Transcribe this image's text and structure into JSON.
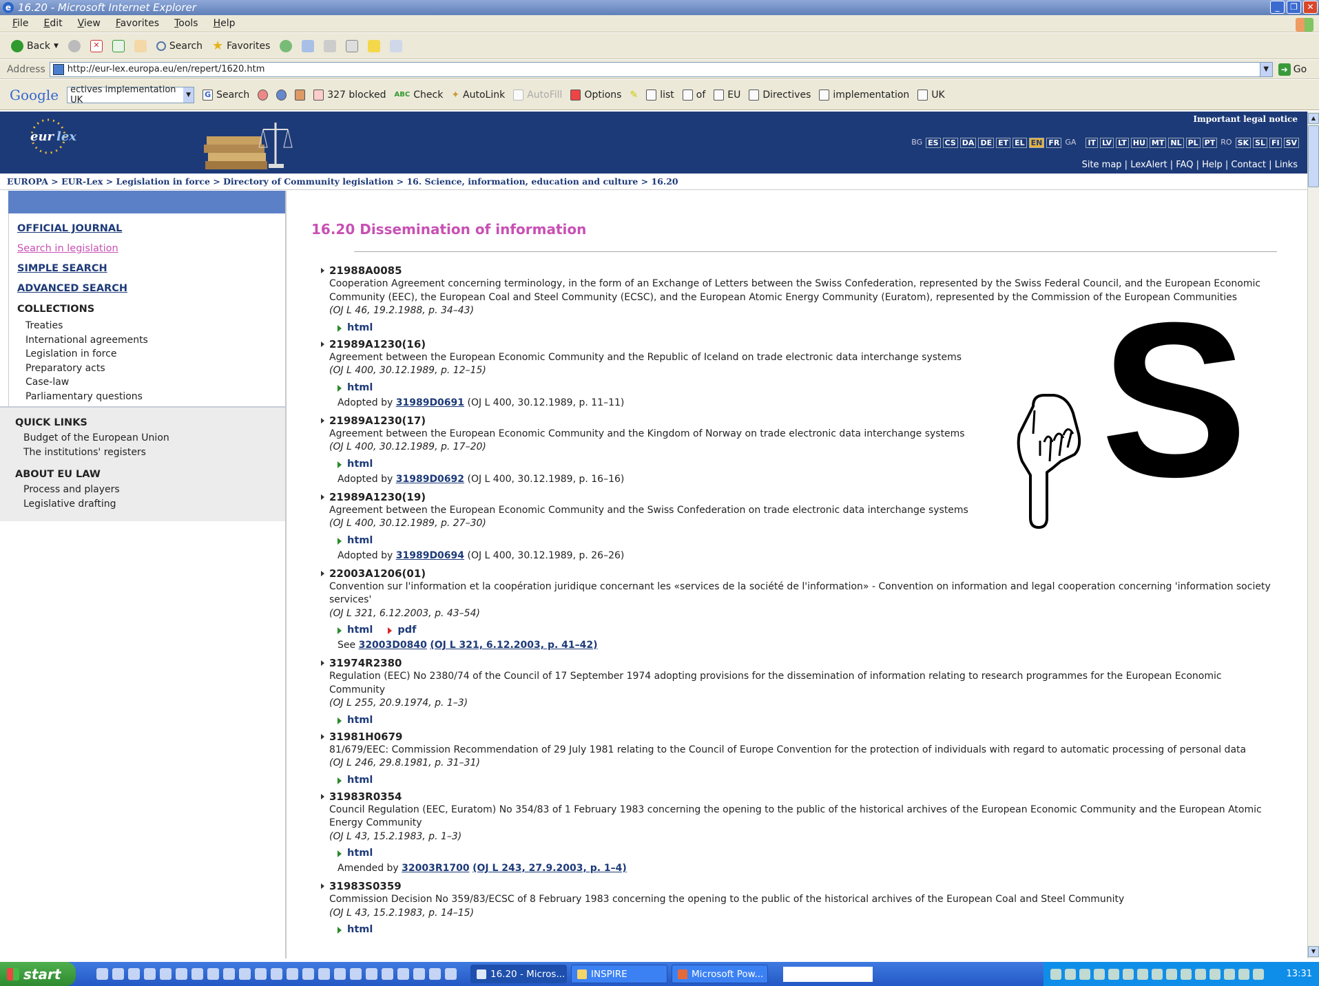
{
  "window": {
    "title": "16.20 - Microsoft Internet Explorer"
  },
  "menu": [
    "File",
    "Edit",
    "View",
    "Favorites",
    "Tools",
    "Help"
  ],
  "toolbar": {
    "back": "Back",
    "search": "Search",
    "favorites": "Favorites"
  },
  "address": {
    "label": "Address",
    "url": "http://eur-lex.europa.eu/en/repert/1620.htm",
    "go": "Go"
  },
  "googlebar": {
    "logo": "Google",
    "query": "ectives implementation UK",
    "search": "Search",
    "blocked": "327 blocked",
    "check": "Check",
    "autolink": "AutoLink",
    "autofill": "AutoFill",
    "options": "Options",
    "terms": [
      "list",
      "of",
      "EU",
      "Directives",
      "implementation",
      "UK"
    ]
  },
  "banner": {
    "legal_notice": "Important legal notice",
    "languages": [
      "BG",
      "ES",
      "CS",
      "DA",
      "DE",
      "ET",
      "EL",
      "EN",
      "FR",
      "GA",
      "IT",
      "LV",
      "LT",
      "HU",
      "MT",
      "NL",
      "PL",
      "PT",
      "RO",
      "SK",
      "SL",
      "FI",
      "SV"
    ],
    "active_language": "EN",
    "site_links": "Site map | LexAlert | FAQ | Help | Contact | Links"
  },
  "breadcrumb": "EUROPA > EUR-Lex > Legislation in force > Directory of Community legislation > 16. Science, information, education and culture > 16.20",
  "left": {
    "links": [
      "OFFICIAL JOURNAL",
      "Search in legislation",
      "SIMPLE SEARCH",
      "ADVANCED SEARCH"
    ],
    "collections_heading": "COLLECTIONS",
    "collections": [
      "Treaties",
      "International agreements",
      "Legislation in force",
      "Preparatory acts",
      "Case-law",
      "Parliamentary questions"
    ],
    "quick_links_heading": "QUICK LINKS",
    "quick_links": [
      "Budget of the European Union",
      "The institutions' registers"
    ],
    "about_heading": "ABOUT EU LAW",
    "about": [
      "Process and players",
      "Legislative drafting"
    ]
  },
  "main": {
    "title": "16.20 Dissemination of information",
    "entries": [
      {
        "code": "21988A0085",
        "desc": "Cooperation Agreement concerning terminology, in the form of an Exchange of Letters between the Swiss Confederation, represented by the Swiss Federal Council, and the European Economic Community (EEC), the European Coal and Steel Community (ECSC), and the European Atomic Energy Community (Euratom), represented by the Commission of the European Communities",
        "oj": "(OJ L 46, 19.2.1988, p. 34–43)",
        "formats": [
          "html"
        ]
      },
      {
        "code": "21989A1230(16)",
        "desc": "Agreement between the European Economic Community and the Republic of Iceland on trade electronic data interchange systems",
        "oj": "(OJ L 400, 30.12.1989, p. 12–15)",
        "formats": [
          "html"
        ],
        "note_prefix": "Adopted by",
        "note_link": "31989D0691",
        "note_suffix": "(OJ L 400, 30.12.1989, p. 11–11)"
      },
      {
        "code": "21989A1230(17)",
        "desc": "Agreement between the European Economic Community and the Kingdom of Norway on trade electronic data interchange systems",
        "oj": "(OJ L 400, 30.12.1989, p. 17–20)",
        "formats": [
          "html"
        ],
        "note_prefix": "Adopted by",
        "note_link": "31989D0692",
        "note_suffix": "(OJ L 400, 30.12.1989, p. 16–16)"
      },
      {
        "code": "21989A1230(19)",
        "desc": "Agreement between the European Economic Community and the Swiss Confederation on trade electronic data interchange systems",
        "oj": "(OJ L 400, 30.12.1989, p. 27–30)",
        "formats": [
          "html"
        ],
        "note_prefix": "Adopted by",
        "note_link": "31989D0694",
        "note_suffix": "(OJ L 400, 30.12.1989, p. 26–26)"
      },
      {
        "code": "22003A1206(01)",
        "desc": "Convention sur l'information et la coopération juridique concernant les «services de la société de l'information» - Convention on information and legal cooperation concerning 'information society services'",
        "oj": "(OJ L 321, 6.12.2003, p. 43–54)",
        "formats": [
          "html",
          "pdf"
        ],
        "note_prefix": "See",
        "note_link": "32003D0840",
        "note_link2": "(OJ L 321, 6.12.2003, p. 41–42)"
      },
      {
        "code": "31974R2380",
        "desc": "Regulation (EEC) No 2380/74 of the Council of 17 September 1974 adopting provisions for the dissemination of information relating to research programmes for the European Economic Community",
        "oj": "(OJ L 255, 20.9.1974, p. 1–3)",
        "formats": [
          "html"
        ]
      },
      {
        "code": "31981H0679",
        "desc": "81/679/EEC: Commission Recommendation of 29 July 1981 relating to the Council of Europe Convention for the protection of individuals with regard to automatic processing of personal data",
        "oj": "(OJ L 246, 29.8.1981, p. 31–31)",
        "formats": [
          "html"
        ]
      },
      {
        "code": "31983R0354",
        "desc": "Council Regulation (EEC, Euratom) No 354/83 of 1 February 1983 concerning the opening to the public of the historical archives of the European Economic Community and the European Atomic Energy Community",
        "oj": "(OJ L 43, 15.2.1983, p. 1–3)",
        "formats": [
          "html"
        ],
        "note_prefix": "Amended by",
        "note_link": "32003R1700",
        "note_link2": "(OJ L 243, 27.9.2003, p. 1–4)"
      },
      {
        "code": "31983S0359",
        "desc": "Commission Decision No 359/83/ECSC of 8 February 1983 concerning the opening to the public of the historical archives of the European Coal and Steel Community",
        "oj": "(OJ L 43, 15.2.1983, p. 14–15)",
        "formats": [
          "html"
        ]
      }
    ]
  },
  "overlay": {
    "letter": "S"
  },
  "taskbar": {
    "start": "start",
    "tasks": [
      "16.20 - Micros...",
      "INSPIRE",
      "Microsoft Pow..."
    ],
    "clock": "13:31"
  }
}
